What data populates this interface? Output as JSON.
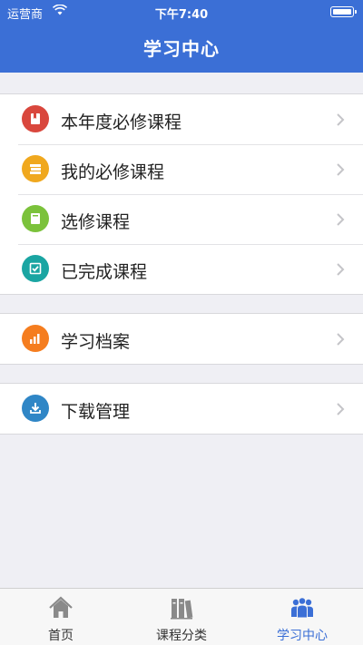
{
  "status_bar": {
    "carrier": "运营商",
    "time": "下午7:40"
  },
  "nav": {
    "title": "学习中心"
  },
  "groups": [
    {
      "items": [
        {
          "label": "本年度必修课程",
          "icon": "book-icon",
          "color": "#d9473d"
        },
        {
          "label": "我的必修课程",
          "icon": "stack-icon",
          "color": "#f0a81e"
        },
        {
          "label": "选修课程",
          "icon": "book-green-icon",
          "color": "#7bc23b"
        },
        {
          "label": "已完成课程",
          "icon": "checkbox-icon",
          "color": "#1aa5a2"
        }
      ]
    },
    {
      "items": [
        {
          "label": "学习档案",
          "icon": "chart-icon",
          "color": "#f57d1f"
        }
      ]
    },
    {
      "items": [
        {
          "label": "下载管理",
          "icon": "download-icon",
          "color": "#2f86c6"
        }
      ]
    }
  ],
  "tabbar": {
    "tabs": [
      {
        "label": "首页",
        "icon": "home-icon"
      },
      {
        "label": "课程分类",
        "icon": "books-icon"
      },
      {
        "label": "学习中心",
        "icon": "people-icon",
        "active": true
      }
    ],
    "active_color": "#3b6fd6"
  },
  "colors": {
    "header": "#3b6fd6",
    "background": "#efeff4"
  }
}
